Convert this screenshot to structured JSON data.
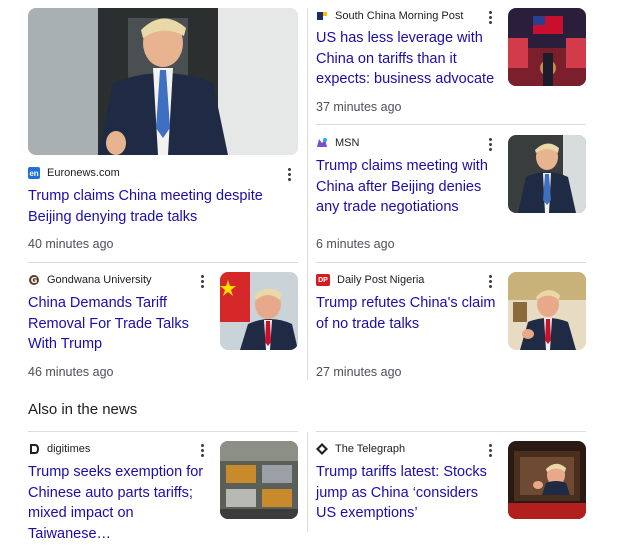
{
  "section_heading": "Also in the news",
  "articles": [
    {
      "source": "Euronews.com",
      "source_icon": "euronews-icon",
      "headline": "Trump claims China meeting despite Beijing denying trade talks",
      "time": "40 minutes ago"
    },
    {
      "source": "South China Morning Post",
      "source_icon": "scmp-icon",
      "headline": "US has less leverage with China on tariffs than it expects: business advocate",
      "time": "37 minutes ago"
    },
    {
      "source": "MSN",
      "source_icon": "msn-icon",
      "headline": "Trump claims meeting with China after Beijing denies any trade negotiations",
      "time": "6 minutes ago"
    },
    {
      "source": "Gondwana University",
      "source_icon": "gondwana-icon",
      "headline": "China Demands Tariff Removal For Trade Talks With Trump",
      "time": "46 minutes ago"
    },
    {
      "source": "Daily Post Nigeria",
      "source_icon": "dailypost-icon",
      "headline": "Trump refutes China's claim of no trade talks",
      "time": "27 minutes ago"
    },
    {
      "source": "digitimes",
      "source_icon": "digitimes-icon",
      "headline": "Trump seeks exemption for Chinese auto parts tariffs; mixed impact on Taiwanese…"
    },
    {
      "source": "The Telegraph",
      "source_icon": "telegraph-icon",
      "headline": "Trump tariffs latest: Stocks jump as China ‘considers US exemptions’"
    }
  ],
  "favicon_text": {
    "euronews": "en",
    "dailypost": "DP"
  },
  "colors": {
    "link": "#1a0dab",
    "divider": "#dadce0",
    "meta": "#4d5156"
  }
}
